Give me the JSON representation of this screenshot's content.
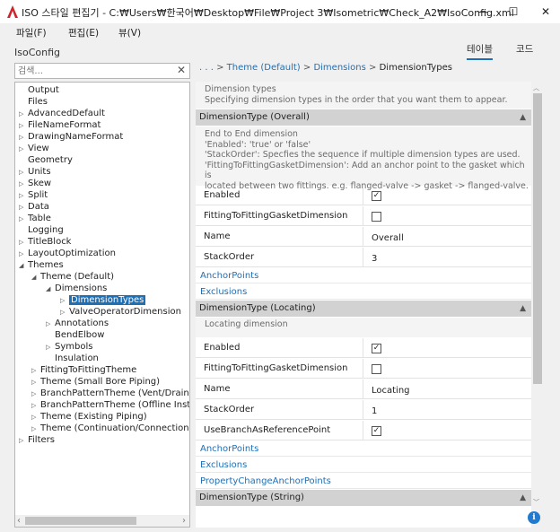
{
  "window": {
    "title": "ISO 스타일 편집기 - C:₩Users₩한국어₩Desktop₩File₩Project 3₩Isometric₩Check_A2₩IsoConfig.xml",
    "minimize": "—",
    "maximize": "☐",
    "close": "✕",
    "logo_color": "#d1232a"
  },
  "menu": {
    "file": "파일(F)",
    "edit": "편집(E)",
    "view": "뷰(V)"
  },
  "app_name": "IsoConfig",
  "view_tabs": {
    "table": "테이블",
    "code": "코드"
  },
  "search": {
    "placeholder": "검색...",
    "clear": "✕"
  },
  "breadcrumb": {
    "ellipsis": ". . .",
    "sep1": ">",
    "item1": "Theme (Default)",
    "sep2": ">",
    "item2": "Dimensions",
    "sep3": ">",
    "current": "DimensionTypes"
  },
  "tree": [
    {
      "label": "Output",
      "arrow": ""
    },
    {
      "label": "Files",
      "arrow": ""
    },
    {
      "label": "AdvancedDefault",
      "arrow": "▷"
    },
    {
      "label": "FileNameFormat",
      "arrow": "▷"
    },
    {
      "label": "DrawingNameFormat",
      "arrow": "▷"
    },
    {
      "label": "View",
      "arrow": "▷"
    },
    {
      "label": "Geometry",
      "arrow": ""
    },
    {
      "label": "Units",
      "arrow": "▷"
    },
    {
      "label": "Skew",
      "arrow": "▷"
    },
    {
      "label": "Split",
      "arrow": "▷"
    },
    {
      "label": "Data",
      "arrow": "▷"
    },
    {
      "label": "Table",
      "arrow": "▷"
    },
    {
      "label": "Logging",
      "arrow": ""
    },
    {
      "label": "TitleBlock",
      "arrow": "▷"
    },
    {
      "label": "LayoutOptimization",
      "arrow": "▷"
    },
    {
      "label": "Themes",
      "arrow": "◢"
    },
    {
      "label": "Theme (Default)",
      "arrow": "◢"
    },
    {
      "label": "Dimensions",
      "arrow": "◢"
    },
    {
      "label": "DimensionTypes",
      "arrow": "▷"
    },
    {
      "label": "ValveOperatorDimension",
      "arrow": "▷"
    },
    {
      "label": "Annotations",
      "arrow": "▷"
    },
    {
      "label": "BendElbow",
      "arrow": ""
    },
    {
      "label": "Symbols",
      "arrow": "▷"
    },
    {
      "label": "Insulation",
      "arrow": ""
    },
    {
      "label": "FittingToFittingTheme",
      "arrow": "▷"
    },
    {
      "label": "Theme (Small Bore Piping)",
      "arrow": "▷"
    },
    {
      "label": "BranchPatternTheme (Vent/Drain Pip",
      "arrow": "▷"
    },
    {
      "label": "BranchPatternTheme (Offline Instrum",
      "arrow": "▷"
    },
    {
      "label": "Theme (Existing Piping)",
      "arrow": "▷"
    },
    {
      "label": "Theme (Continuation/Connection Pip",
      "arrow": "▷"
    },
    {
      "label": "Filters",
      "arrow": "▷"
    }
  ],
  "panel": {
    "top_desc": {
      "line1": "Dimension types",
      "line2": "Specifying dimension types in the order that you want them to appear."
    },
    "overall": {
      "header": "DimensionType (Overall)",
      "desc": [
        "End to End dimension",
        "'Enabled': 'true' or 'false'",
        "'StackOrder': Specfies the sequence if multiple dimension types are used.",
        "'FittingToFittingGasketDimension': Add an anchor point to the gasket which is",
        "located between two fittings. e.g. flanged-valve -> gasket -> flanged-valve."
      ],
      "rows": [
        {
          "name": "Enabled",
          "value": "✓",
          "type": "check"
        },
        {
          "name": "FittingToFittingGasketDimension",
          "value": "",
          "type": "check"
        },
        {
          "name": "Name",
          "value": "Overall",
          "type": "text"
        },
        {
          "name": "StackOrder",
          "value": "3",
          "type": "text"
        }
      ],
      "links": [
        "AnchorPoints",
        "Exclusions"
      ]
    },
    "locating": {
      "header": "DimensionType (Locating)",
      "desc": [
        "Locating dimension"
      ],
      "rows": [
        {
          "name": "Enabled",
          "value": "✓",
          "type": "check"
        },
        {
          "name": "FittingToFittingGasketDimension",
          "value": "",
          "type": "check"
        },
        {
          "name": "Name",
          "value": "Locating",
          "type": "text"
        },
        {
          "name": "StackOrder",
          "value": "1",
          "type": "text"
        },
        {
          "name": "UseBranchAsReferencePoint",
          "value": "✓",
          "type": "check"
        }
      ],
      "links": [
        "AnchorPoints",
        "Exclusions",
        "PropertyChangeAnchorPoints"
      ]
    },
    "string": {
      "header": "DimensionType (String)"
    },
    "collapse_arrow": "▲"
  },
  "scroll": {
    "up": "︿",
    "down": "﹀",
    "left": "‹",
    "right": "›"
  },
  "info_icon": "i"
}
